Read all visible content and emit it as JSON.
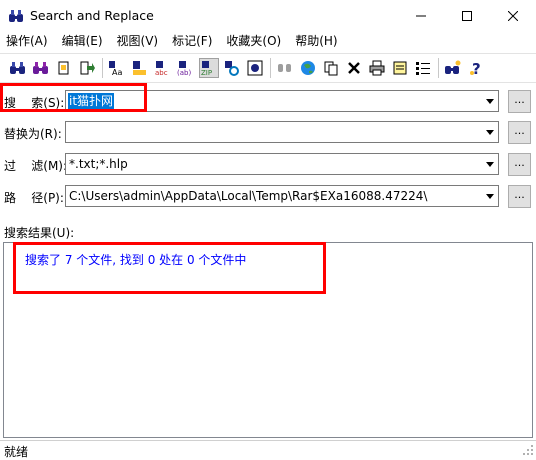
{
  "window": {
    "title": "Search and Replace",
    "controls": [
      "minimize-icon",
      "maximize-icon",
      "close-icon"
    ]
  },
  "menu": [
    "操作(A)",
    "编辑(E)",
    "视图(V)",
    "标记(F)",
    "收藏夹(O)",
    "帮助(H)"
  ],
  "toolbar_icons": [
    "find-icon",
    "find-next-icon",
    "mark-icon",
    "goto-icon",
    "case-icon",
    "whole-word-icon",
    "abc-icon",
    "regex-icon",
    "zip-icon",
    "refresh-icon",
    "web-icon",
    "replace-icon",
    "globe-icon",
    "copy-icon",
    "delete-icon",
    "print-icon",
    "notes-icon",
    "list-icon",
    "about-icon",
    "help-icon"
  ],
  "search": {
    "label": "搜    索(S):",
    "value": "it猫扑网"
  },
  "replace": {
    "label": "替换为(R):",
    "value": ""
  },
  "filter": {
    "label": "过    滤(M):",
    "value": "*.txt;*.hlp"
  },
  "path": {
    "label": "路    径(P):",
    "value": "C:\\Users\\admin\\AppData\\Local\\Temp\\Rar$EXa16088.47224\\"
  },
  "browse_label": "...",
  "results": {
    "label": "搜索结果(U):",
    "message": "搜索了 7 个文件, 找到 0 处在 0 个文件中"
  },
  "status": "就绪",
  "colors": {
    "highlight": "#ff0000",
    "result_text": "#0000ff",
    "selection": "#0078d7"
  }
}
